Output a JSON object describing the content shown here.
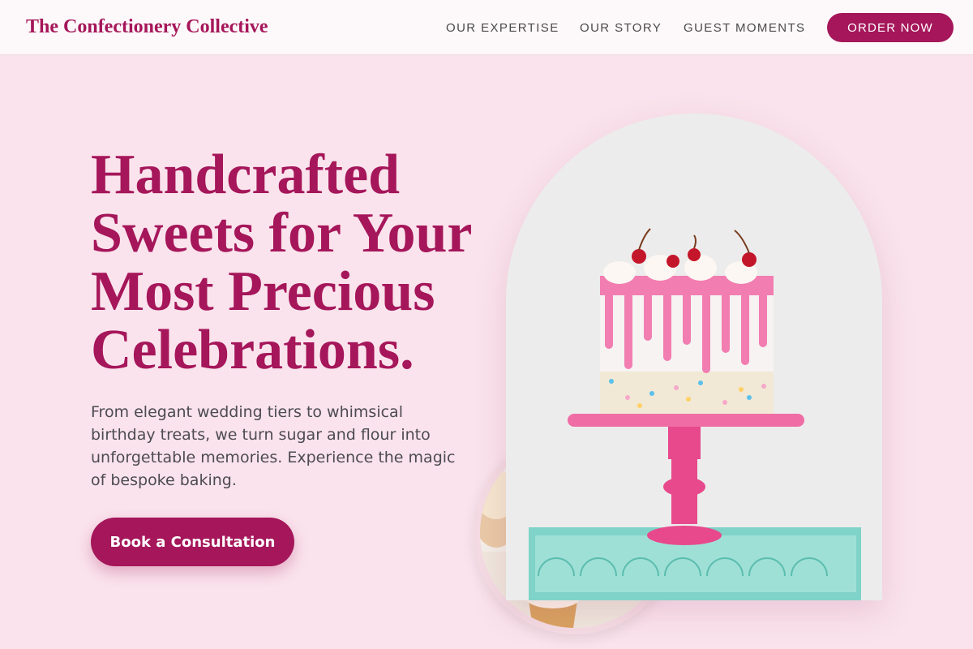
{
  "nav": {
    "brand": "The Confectionery Collective",
    "links": [
      "OUR EXPERTISE",
      "OUR STORY",
      "GUEST MOMENTS"
    ],
    "order_label": "ORDER NOW"
  },
  "hero": {
    "headline": "Handcrafted Sweets for Your Most Precious Celebrations.",
    "subtitle": "From elegant wedding tiers to whimsical birthday treats, we turn sugar and flour into unforgettable memories. Experience the magic of bespoke baking.",
    "cta_label": "Book a Consultation"
  },
  "colors": {
    "brand": "#a5165a",
    "background": "#fae3ec",
    "nav_background": "#fdf8f9",
    "body_text": "#4d4b52"
  }
}
